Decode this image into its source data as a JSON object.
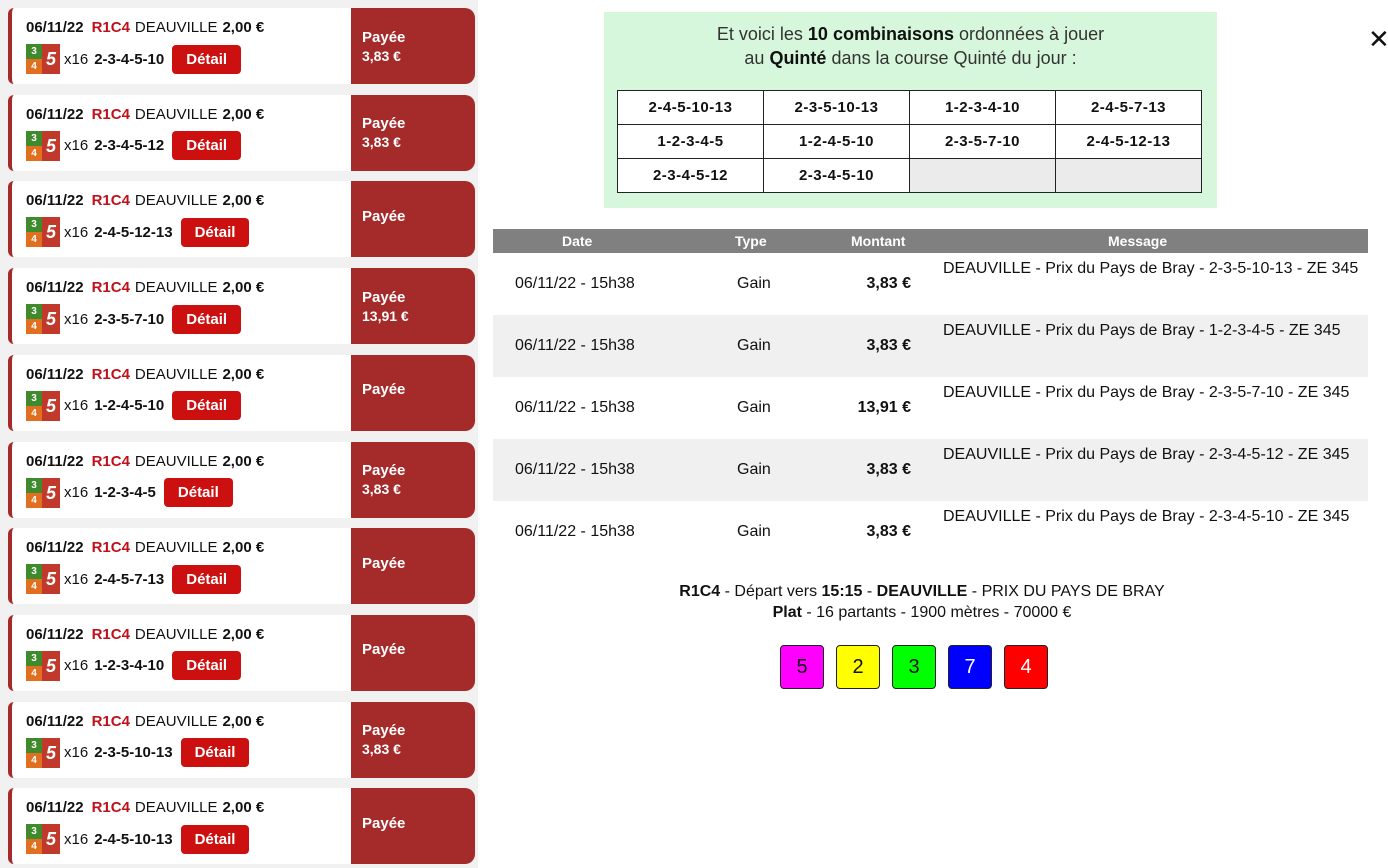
{
  "bets": [
    {
      "date": "06/11/22",
      "race": "R1C4",
      "venue": "DEAUVILLE",
      "amount": "2,00 €",
      "multiplier": "x16",
      "combo": "2-3-4-5-10",
      "detail": "Détail",
      "status": "Payée",
      "payout": "3,83 €"
    },
    {
      "date": "06/11/22",
      "race": "R1C4",
      "venue": "DEAUVILLE",
      "amount": "2,00 €",
      "multiplier": "x16",
      "combo": "2-3-4-5-12",
      "detail": "Détail",
      "status": "Payée",
      "payout": "3,83 €"
    },
    {
      "date": "06/11/22",
      "race": "R1C4",
      "venue": "DEAUVILLE",
      "amount": "2,00 €",
      "multiplier": "x16",
      "combo": "2-4-5-12-13",
      "detail": "Détail",
      "status": "Payée",
      "payout": ""
    },
    {
      "date": "06/11/22",
      "race": "R1C4",
      "venue": "DEAUVILLE",
      "amount": "2,00 €",
      "multiplier": "x16",
      "combo": "2-3-5-7-10",
      "detail": "Détail",
      "status": "Payée",
      "payout": "13,91 €"
    },
    {
      "date": "06/11/22",
      "race": "R1C4",
      "venue": "DEAUVILLE",
      "amount": "2,00 €",
      "multiplier": "x16",
      "combo": "1-2-4-5-10",
      "detail": "Détail",
      "status": "Payée",
      "payout": ""
    },
    {
      "date": "06/11/22",
      "race": "R1C4",
      "venue": "DEAUVILLE",
      "amount": "2,00 €",
      "multiplier": "x16",
      "combo": "1-2-3-4-5",
      "detail": "Détail",
      "status": "Payée",
      "payout": "3,83 €"
    },
    {
      "date": "06/11/22",
      "race": "R1C4",
      "venue": "DEAUVILLE",
      "amount": "2,00 €",
      "multiplier": "x16",
      "combo": "2-4-5-7-13",
      "detail": "Détail",
      "status": "Payée",
      "payout": ""
    },
    {
      "date": "06/11/22",
      "race": "R1C4",
      "venue": "DEAUVILLE",
      "amount": "2,00 €",
      "multiplier": "x16",
      "combo": "1-2-3-4-10",
      "detail": "Détail",
      "status": "Payée",
      "payout": ""
    },
    {
      "date": "06/11/22",
      "race": "R1C4",
      "venue": "DEAUVILLE",
      "amount": "2,00 €",
      "multiplier": "x16",
      "combo": "2-3-5-10-13",
      "detail": "Détail",
      "status": "Payée",
      "payout": "3,83 €"
    },
    {
      "date": "06/11/22",
      "race": "R1C4",
      "venue": "DEAUVILLE",
      "amount": "2,00 €",
      "multiplier": "x16",
      "combo": "2-4-5-10-13",
      "detail": "Détail",
      "status": "Payée",
      "payout": ""
    }
  ],
  "badge": {
    "d3": "3",
    "d4": "4",
    "d5": "5"
  },
  "close": {
    "label": "✕"
  },
  "combinations": {
    "intro_part1": "Et voici les ",
    "intro_bold1": "10 combinaisons",
    "intro_part2": " ordonnées à jouer",
    "intro_part3": "au ",
    "intro_bold2": "Quinté",
    "intro_part4": " dans la course Quinté du jour :",
    "rows": [
      [
        "2-4-5-10-13",
        "2-3-5-10-13",
        "1-2-3-4-10",
        "2-4-5-7-13"
      ],
      [
        "1-2-3-4-5",
        "1-2-4-5-10",
        "2-3-5-7-10",
        "2-4-5-12-13"
      ],
      [
        "2-3-4-5-12",
        "2-3-4-5-10",
        "",
        ""
      ]
    ]
  },
  "transactions": {
    "headers": {
      "date": "Date",
      "type": "Type",
      "amount": "Montant",
      "message": "Message"
    },
    "rows": [
      {
        "date": "06/11/22 - 15h38",
        "type": "Gain",
        "amount": "3,83 €",
        "message": "DEAUVILLE - Prix du Pays de Bray - 2-3-5-10-13 - ZE 345"
      },
      {
        "date": "06/11/22 - 15h38",
        "type": "Gain",
        "amount": "3,83 €",
        "message": "DEAUVILLE - Prix du Pays de Bray - 1-2-3-4-5 - ZE 345"
      },
      {
        "date": "06/11/22 - 15h38",
        "type": "Gain",
        "amount": "13,91 €",
        "message": "DEAUVILLE - Prix du Pays de Bray - 2-3-5-7-10 - ZE 345"
      },
      {
        "date": "06/11/22 - 15h38",
        "type": "Gain",
        "amount": "3,83 €",
        "message": "DEAUVILLE - Prix du Pays de Bray - 2-3-4-5-12 - ZE 345"
      },
      {
        "date": "06/11/22 - 15h38",
        "type": "Gain",
        "amount": "3,83 €",
        "message": "DEAUVILLE - Prix du Pays de Bray - 2-3-4-5-10 - ZE 345"
      }
    ]
  },
  "race": {
    "code": "R1C4",
    "depart_label": " - Départ vers ",
    "time": "15:15",
    "sep1": " - ",
    "venue": "DEAUVILLE",
    "sep2": " - ",
    "name": "PRIX DU PAYS DE BRAY",
    "discipline": "Plat",
    "details": " - 16 partants - 1900 mètres - 70000 €"
  },
  "arrival": [
    {
      "number": "5",
      "color": "#ff00ff",
      "text_color": "#111111"
    },
    {
      "number": "2",
      "color": "#ffff00",
      "text_color": "#111111"
    },
    {
      "number": "3",
      "color": "#00ff00",
      "text_color": "#111111"
    },
    {
      "number": "7",
      "color": "#0000ff",
      "text_color": "#ffffff"
    },
    {
      "number": "4",
      "color": "#ff0000",
      "text_color": "#ffffff"
    }
  ]
}
